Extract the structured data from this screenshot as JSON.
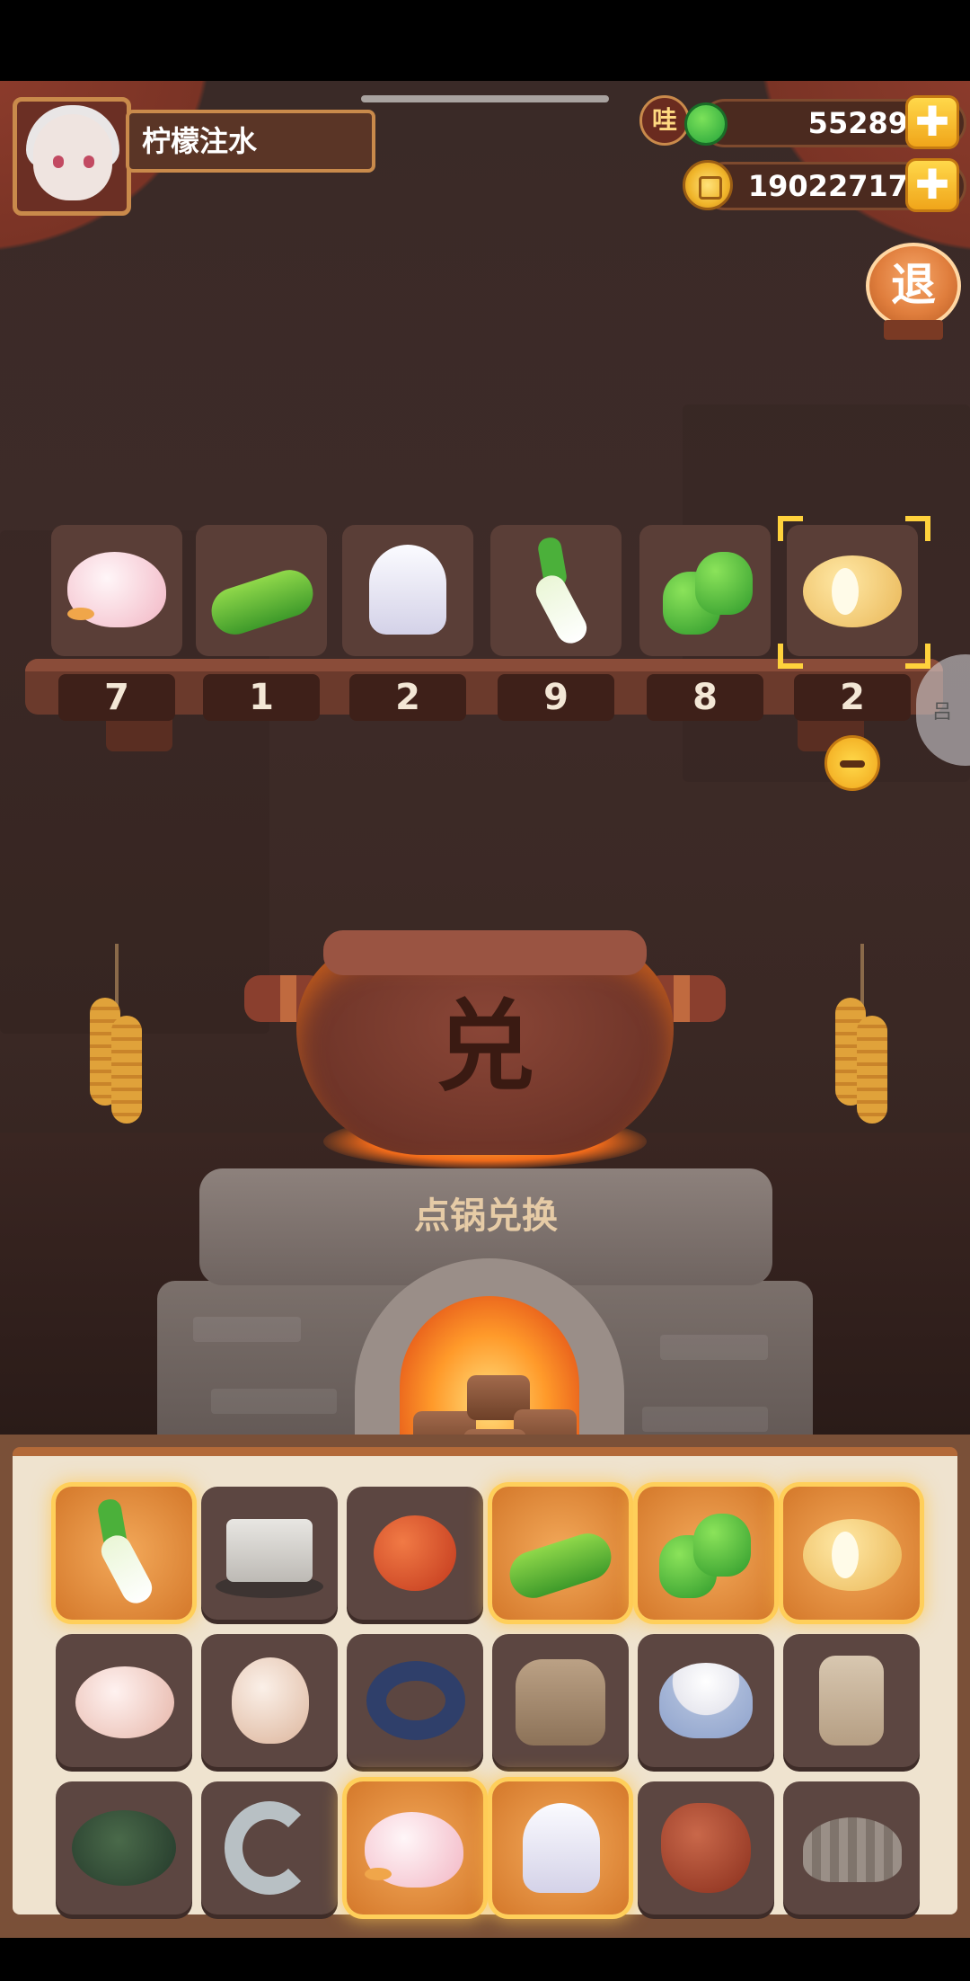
{
  "player": {
    "name": "柠檬注水"
  },
  "currency": {
    "gems": "55289",
    "coins": "19022717",
    "wa_label": "哇",
    "add_symbol": "✚"
  },
  "buttons": {
    "exit_label": "退"
  },
  "shelf": {
    "items": [
      {
        "icon": "goose-icon",
        "count": "7"
      },
      {
        "icon": "cucumber-icon",
        "count": "1"
      },
      {
        "icon": "squid-icon",
        "count": "2"
      },
      {
        "icon": "leek-icon",
        "count": "9"
      },
      {
        "icon": "green-pepper-icon",
        "count": "8"
      },
      {
        "icon": "potato-icon",
        "count": "2"
      }
    ],
    "selected_index": 5
  },
  "pot": {
    "character": "兑",
    "action_label": "点锅兑换"
  },
  "side_handle": {
    "label": "吕"
  },
  "inventory": {
    "rows": [
      [
        "leek-icon",
        "tofu-icon",
        "tomato-icon",
        "cucumber-icon",
        "green-pepper-icon",
        "potato-icon"
      ],
      [
        "chicken-icon",
        "egg-icon",
        "fish-icon",
        "flour-sack-icon",
        "rice-bowl-icon",
        "jar-icon"
      ],
      [
        "crab-icon",
        "shrimp-icon",
        "goose-icon",
        "squid-icon",
        "meat-icon",
        "clam-icon"
      ]
    ],
    "selected": [
      "leek-icon",
      "cucumber-icon",
      "green-pepper-icon",
      "potato-icon",
      "goose-icon",
      "squid-icon"
    ]
  },
  "colors": {
    "accent": "#ffcf5a",
    "panel": "#efe3cf",
    "background": "#3a2a27"
  }
}
